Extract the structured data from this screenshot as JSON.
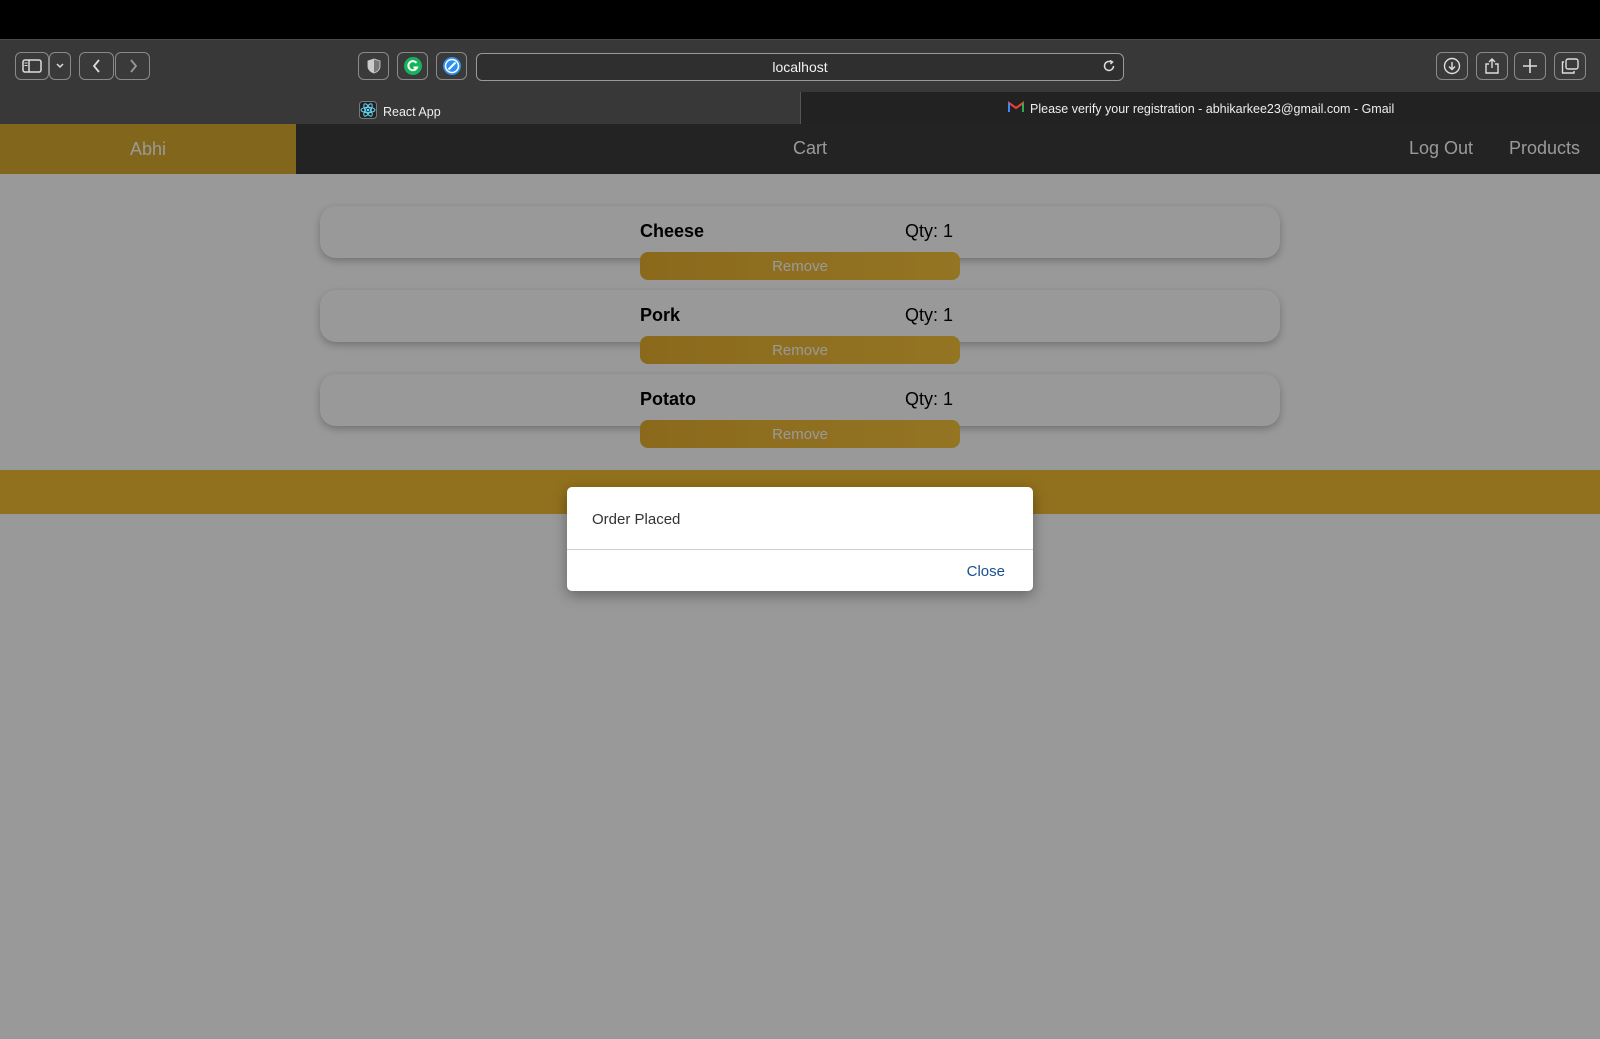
{
  "browser": {
    "url": "localhost",
    "tabs": [
      {
        "label": "React App",
        "active": true,
        "icon": "react-icon"
      },
      {
        "label": "Please verify your registration - abhikarkee23@gmail.com - Gmail",
        "active": false,
        "icon": "gmail-icon"
      }
    ]
  },
  "nav": {
    "user": "Abhi",
    "cart": "Cart",
    "logout": "Log Out",
    "products": "Products"
  },
  "cart": {
    "items": [
      {
        "name": "Cheese",
        "qty": "Qty: 1",
        "remove_label": "Remove"
      },
      {
        "name": "Pork",
        "qty": "Qty: 1",
        "remove_label": "Remove"
      },
      {
        "name": "Potato",
        "qty": "Qty: 1",
        "remove_label": "Remove"
      }
    ]
  },
  "dialog": {
    "message": "Order Placed",
    "close_label": "Close"
  },
  "colors": {
    "accent": "#f2bd31",
    "navbar": "#3b3b3b",
    "link": "#1a4f8f"
  }
}
